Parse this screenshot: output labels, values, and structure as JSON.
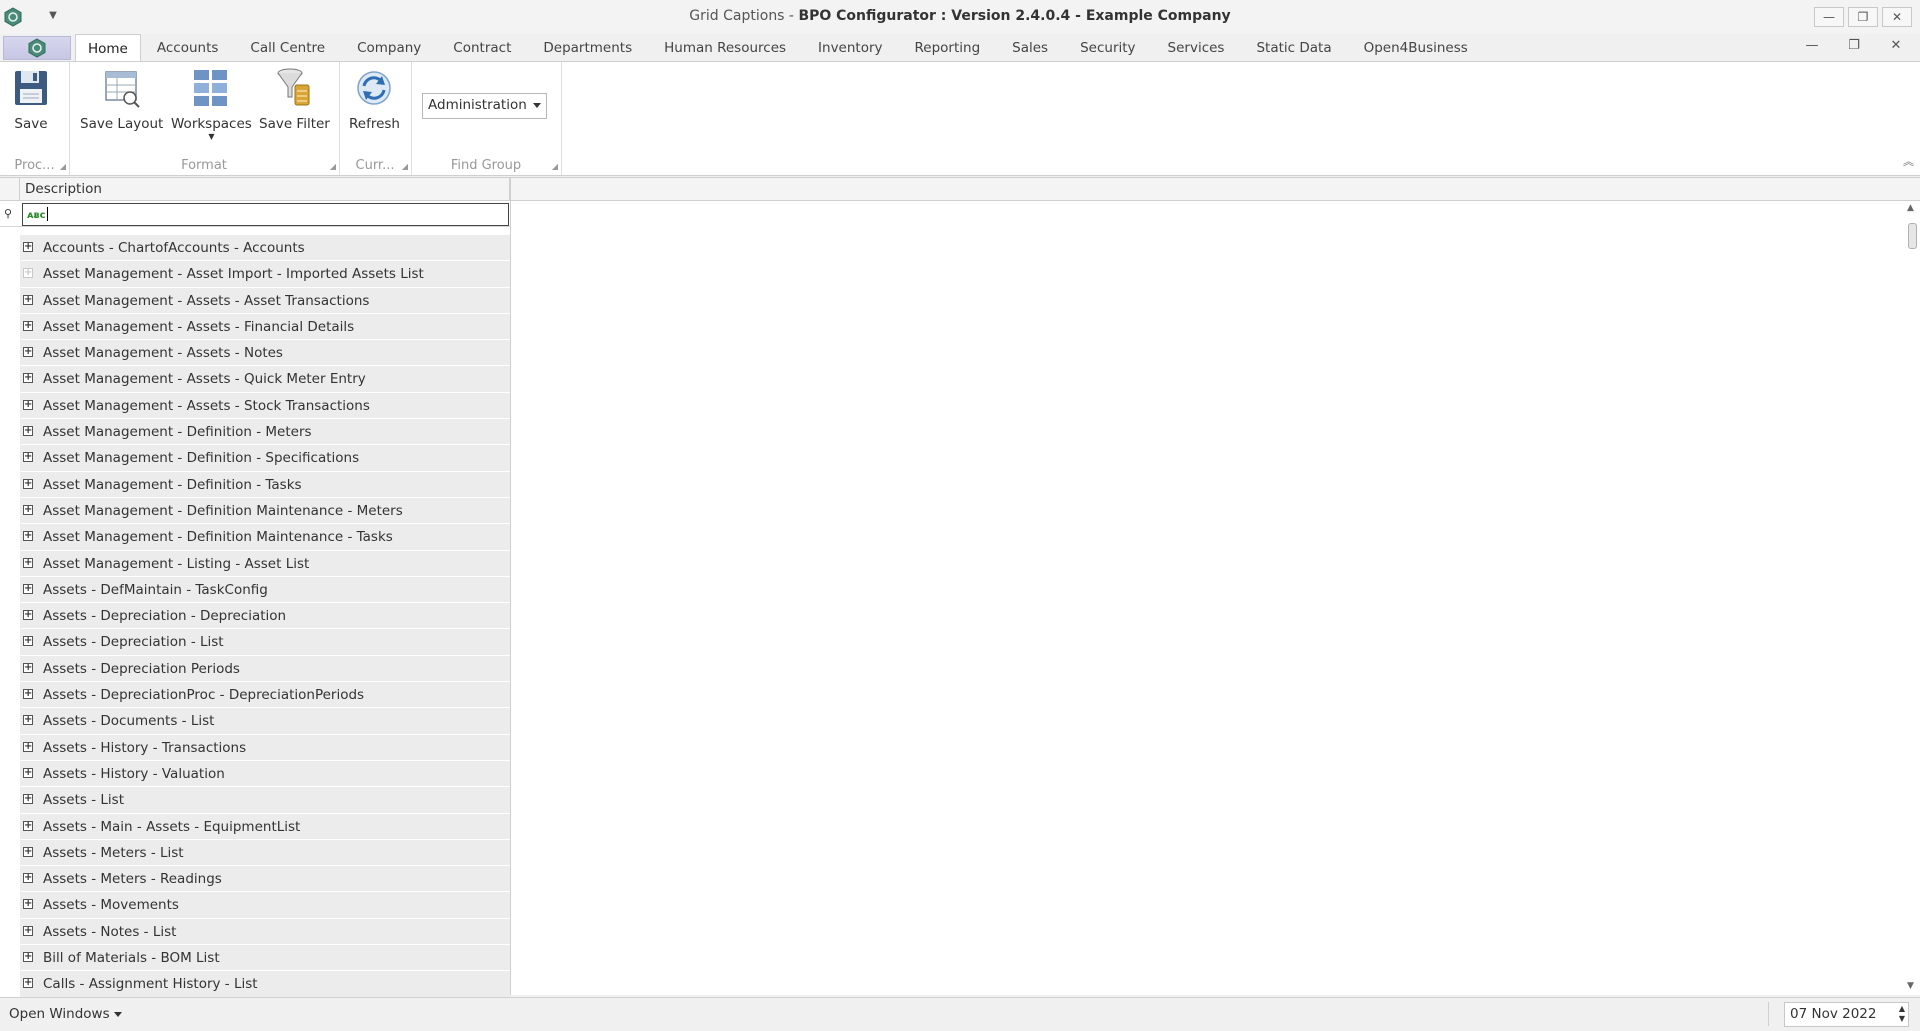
{
  "window": {
    "title_prefix": "Grid Captions - ",
    "title_app": "BPO Configurator : Version 2.4.0.4 - Example Company",
    "minimize": "—",
    "restore": "❐",
    "close": "✕"
  },
  "tabs": [
    {
      "label": "Home",
      "active": true
    },
    {
      "label": "Accounts"
    },
    {
      "label": "Call Centre"
    },
    {
      "label": "Company"
    },
    {
      "label": "Contract"
    },
    {
      "label": "Departments"
    },
    {
      "label": "Human Resources"
    },
    {
      "label": "Inventory"
    },
    {
      "label": "Reporting"
    },
    {
      "label": "Sales"
    },
    {
      "label": "Security"
    },
    {
      "label": "Services"
    },
    {
      "label": "Static Data"
    },
    {
      "label": "Open4Business"
    }
  ],
  "ribbon": {
    "groups": {
      "process": "Proc...",
      "format": "Format",
      "current": "Curr...",
      "find_group": "Find Group"
    },
    "buttons": {
      "save": "Save",
      "save_layout": "Save Layout",
      "workspaces": "Workspaces",
      "save_filter": "Save Filter",
      "refresh": "Refresh"
    },
    "find_group_value": "Administration"
  },
  "grid": {
    "column_header": "Description",
    "filter_operator": "ᴀᴃc",
    "filter_value": "",
    "rows": [
      {
        "text": "Accounts - ChartofAccounts - Accounts",
        "expandable": true
      },
      {
        "text": "Asset Management - Asset Import  - Imported Assets List",
        "expandable": false
      },
      {
        "text": "Asset Management - Assets - Asset Transactions",
        "expandable": true
      },
      {
        "text": "Asset Management - Assets - Financial Details",
        "expandable": true
      },
      {
        "text": "Asset Management - Assets - Notes",
        "expandable": true
      },
      {
        "text": "Asset Management - Assets - Quick Meter Entry",
        "expandable": true
      },
      {
        "text": "Asset Management - Assets - Stock Transactions",
        "expandable": true
      },
      {
        "text": "Asset Management - Definition - Meters",
        "expandable": true
      },
      {
        "text": "Asset Management - Definition - Specifications",
        "expandable": true
      },
      {
        "text": "Asset Management - Definition - Tasks",
        "expandable": true
      },
      {
        "text": "Asset Management - Definition Maintenance - Meters",
        "expandable": true
      },
      {
        "text": "Asset Management - Definition Maintenance - Tasks",
        "expandable": true
      },
      {
        "text": "Asset Management - Listing - Asset List",
        "expandable": true
      },
      {
        "text": "Assets - DefMaintain - TaskConfig",
        "expandable": true
      },
      {
        "text": "Assets - Depreciation - Depreciation",
        "expandable": true
      },
      {
        "text": "Assets - Depreciation - List",
        "expandable": true
      },
      {
        "text": "Assets - Depreciation Periods",
        "expandable": true
      },
      {
        "text": "Assets - DepreciationProc - DepreciationPeriods",
        "expandable": true
      },
      {
        "text": "Assets - Documents - List",
        "expandable": true
      },
      {
        "text": "Assets - History - Transactions",
        "expandable": true
      },
      {
        "text": "Assets - History - Valuation",
        "expandable": true
      },
      {
        "text": "Assets - List",
        "expandable": true
      },
      {
        "text": "Assets - Main - Assets - EquipmentList",
        "expandable": true
      },
      {
        "text": "Assets - Meters - List",
        "expandable": true
      },
      {
        "text": "Assets - Meters - Readings",
        "expandable": true
      },
      {
        "text": "Assets - Movements",
        "expandable": true
      },
      {
        "text": "Assets - Notes - List",
        "expandable": true
      },
      {
        "text": "Bill of Materials - BOM List",
        "expandable": true
      },
      {
        "text": "Calls - Assignment History - List",
        "expandable": true
      }
    ]
  },
  "status": {
    "open_windows": "Open Windows",
    "date": "07 Nov 2022"
  }
}
